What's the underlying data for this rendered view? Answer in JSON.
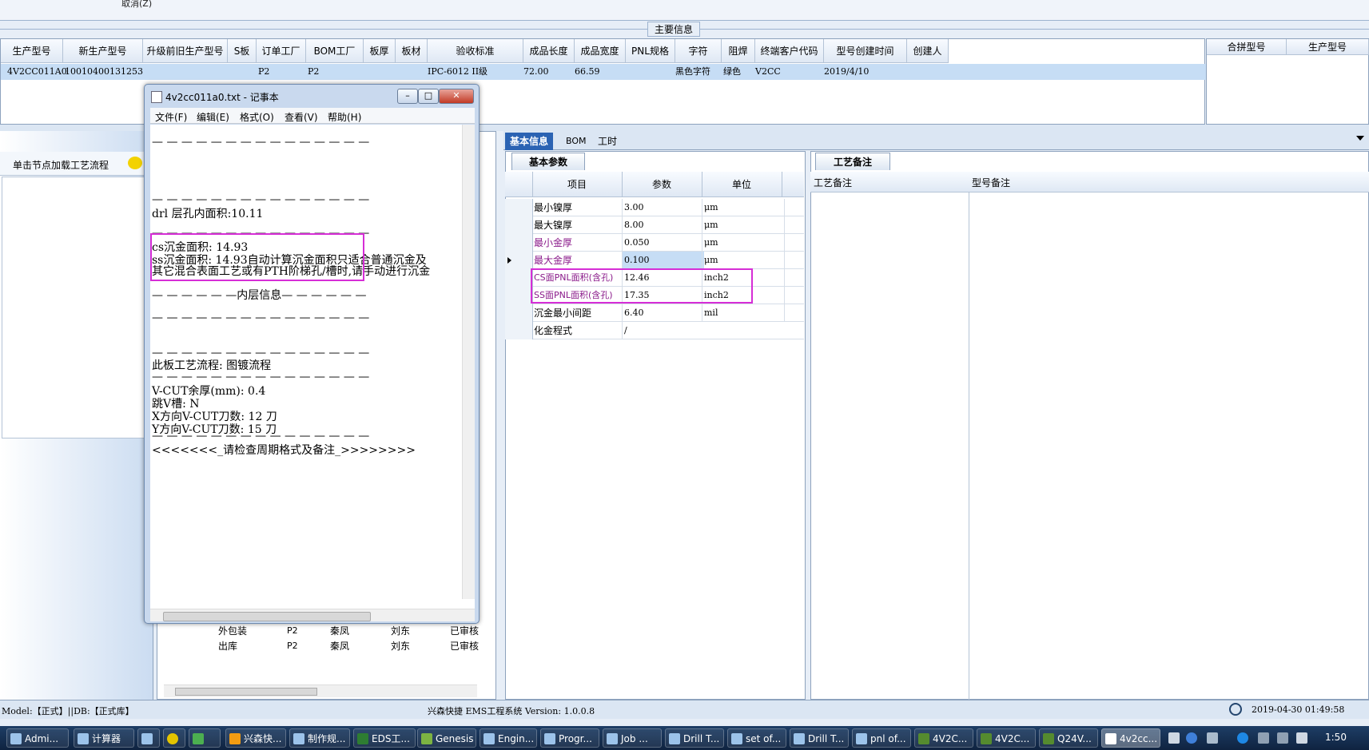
{
  "topbar": {
    "cancel": "取消(Z)"
  },
  "main_info": {
    "caption": "主要信息"
  },
  "main_grid": {
    "headers": [
      "生产型号",
      "新生产型号",
      "升级前旧生产型号",
      "S板",
      "订单工厂",
      "BOM工厂",
      "板厚",
      "板材",
      "验收标准",
      "成品长度",
      "成品宽度",
      "PNL规格",
      "字符",
      "阻焊",
      "终端客户代码",
      "型号创建时间",
      "创建人"
    ],
    "row": [
      "4V2CC011A0",
      "10010400131253",
      "",
      "",
      "P2",
      "P2",
      "",
      "",
      "IPC-6012 II级",
      "72.00",
      "66.59",
      "",
      "黑色字符",
      "绿色",
      "V2CC",
      "2019/4/10",
      ""
    ]
  },
  "side_grid": {
    "headers": [
      "合拼型号",
      "生产型号"
    ]
  },
  "left_panel": {
    "hint": "单击节点加载工艺流程"
  },
  "proc_rows": [
    {
      "name": "外包装",
      "c1": "P2",
      "c2": "秦凤",
      "c3": "刘东",
      "c4": "已审核"
    },
    {
      "name": "出库",
      "c1": "P2",
      "c2": "秦凤",
      "c3": "刘东",
      "c4": "已审核"
    }
  ],
  "tabs": [
    "基本信息",
    "BOM",
    "工时"
  ],
  "params": {
    "tab": "基本参数",
    "headers": [
      "项目",
      "参数",
      "单位"
    ],
    "rows": [
      {
        "item": "最小镍厚",
        "value": "3.00",
        "unit": "μm"
      },
      {
        "item": "最大镍厚",
        "value": "8.00",
        "unit": "μm"
      },
      {
        "item": "最小金厚",
        "value": "0.050",
        "unit": "μm"
      },
      {
        "item": "最大金厚",
        "value": "0.100",
        "unit": "μm"
      },
      {
        "item": "CS面PNL面积(含孔)",
        "value": "12.46",
        "unit": "inch2"
      },
      {
        "item": "SS面PNL面积(含孔)",
        "value": "17.35",
        "unit": "inch2"
      },
      {
        "item": "沉金最小间距",
        "value": "6.40",
        "unit": "mil"
      },
      {
        "item": "化金程式",
        "value": "/",
        "unit": ""
      }
    ]
  },
  "remarks": {
    "tab": "工艺备注",
    "col1": "工艺备注",
    "col2": "型号备注"
  },
  "notepad": {
    "title": "4v2cc011a0.txt - 记事本",
    "menu": [
      "文件(F)",
      "编辑(E)",
      "格式(O)",
      "查看(V)",
      "帮助(H)"
    ],
    "lines": [
      "— — — — — — — — — — — — — — —",
      "— — — — — — — — — — — — — — —",
      "drl          层孔内面积:10.11",
      "— — — — — — — — — — — — — — —",
      "cs沉金面积: 14.93",
      "ss沉金面积: 14.93自动计算沉金面积只适合普通沉金及",
      "其它混合表面工艺或有PTH阶梯孔/槽时,请手动进行沉金",
      "— — — — — —内层信息— — — — — —",
      "— — — — — — — — — — — — — — —",
      "— — — — — — — — — — — — — — —",
      "此板工艺流程: 图镀流程",
      "— — — — — — — — — — — — — — —",
      "V-CUT余厚(mm): 0.4",
      "跳V槽: N",
      "X方向V-CUT刀数: 12 刀",
      "Y方向V-CUT刀数: 15 刀",
      "— — — — — — — — — — — — — — —",
      "<<<<<<<_请检查周期格式及备注_>>>>>>>>"
    ]
  },
  "status": {
    "left": "Model:【正式】||DB:【正式库】",
    "center": "兴森快捷 EMS工程系统 Version: 1.0.0.8",
    "datetime": "2019-04-30 01:49:58"
  },
  "taskbar": {
    "items": [
      "Admi...",
      "计算器",
      "",
      "",
      "",
      "兴森快...",
      "制作规...",
      "EDS工...",
      "Genesis",
      "Engin...",
      "Progr...",
      "Job ...",
      "Drill T...",
      "set of...",
      "Drill T...",
      "pnl of...",
      "4V2C...",
      "4V2C...",
      "Q24V...",
      "4v2cc..."
    ],
    "time": "1:50"
  }
}
